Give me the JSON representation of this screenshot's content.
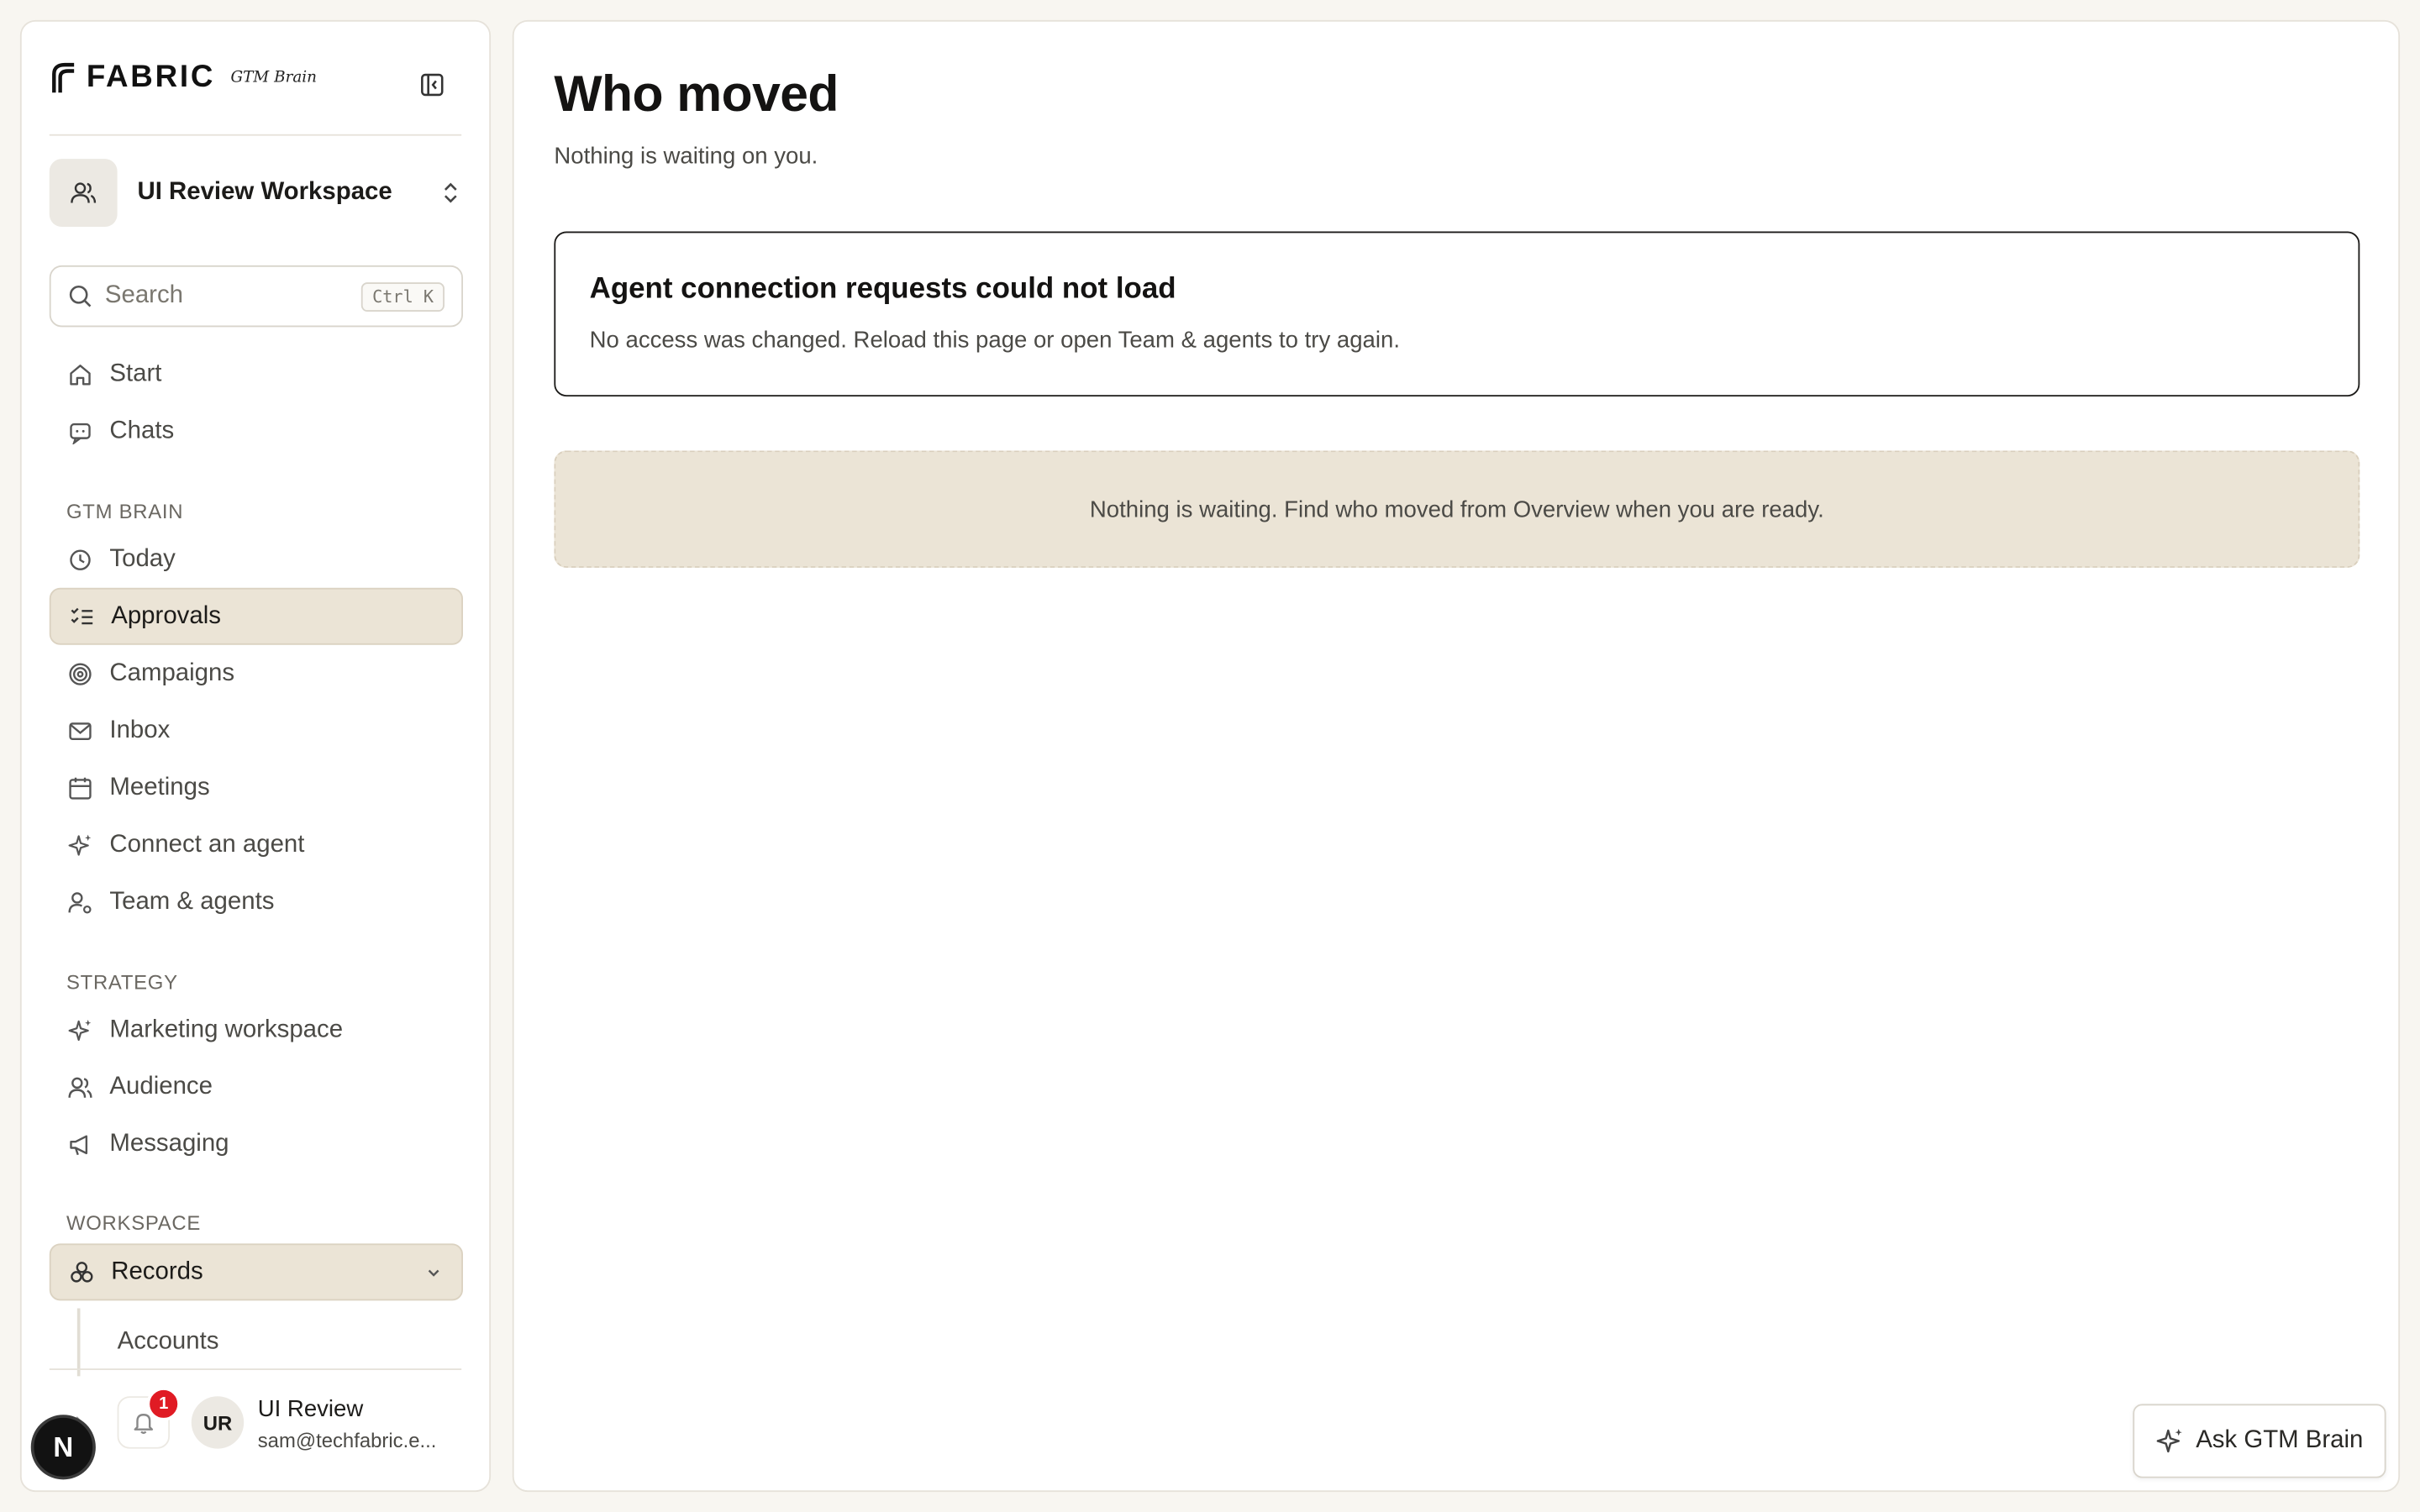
{
  "brand": {
    "name": "FABRIC",
    "product": "GTM Brain"
  },
  "workspace": {
    "name": "UI Review Workspace"
  },
  "search": {
    "placeholder": "Search",
    "shortcut": "Ctrl K"
  },
  "nav_top": [
    {
      "label": "Start",
      "icon": "home-icon"
    },
    {
      "label": "Chats",
      "icon": "chat-icon"
    }
  ],
  "sections": {
    "gtm": "GTM BRAIN",
    "strategy": "STRATEGY",
    "workspace": "WORKSPACE"
  },
  "nav_gtm": [
    {
      "label": "Today",
      "icon": "clock-icon"
    },
    {
      "label": "Approvals",
      "icon": "checklist-icon",
      "active": true
    },
    {
      "label": "Campaigns",
      "icon": "target-icon"
    },
    {
      "label": "Inbox",
      "icon": "mail-icon"
    },
    {
      "label": "Meetings",
      "icon": "calendar-icon"
    },
    {
      "label": "Connect an agent",
      "icon": "sparkle-icon"
    },
    {
      "label": "Team & agents",
      "icon": "user-gear-icon"
    }
  ],
  "nav_strategy": [
    {
      "label": "Marketing workspace",
      "icon": "sparkle-icon"
    },
    {
      "label": "Audience",
      "icon": "users-icon"
    },
    {
      "label": "Messaging",
      "icon": "megaphone-icon"
    }
  ],
  "nav_workspace": [
    {
      "label": "Records",
      "icon": "records-icon",
      "expanded": true
    }
  ],
  "records_children": [
    {
      "label": "Accounts"
    }
  ],
  "notifications": {
    "count": "1"
  },
  "user": {
    "initials": "UR",
    "name": "UI Review",
    "email": "sam@techfabric.e..."
  },
  "dev_badge": "N",
  "main": {
    "title": "Who moved",
    "subtitle": "Nothing is waiting on you.",
    "alert": {
      "title": "Agent connection requests could not load",
      "body": "No access was changed. Reload this page or open Team & agents to try again."
    },
    "empty": "Nothing is waiting. Find who moved from Overview when you are ready."
  },
  "ask_button": {
    "label": "Ask GTM Brain"
  },
  "colors": {
    "active_bg": "#ebe4d6",
    "badge": "#e01b24",
    "page_bg": "#f8f6f1"
  }
}
